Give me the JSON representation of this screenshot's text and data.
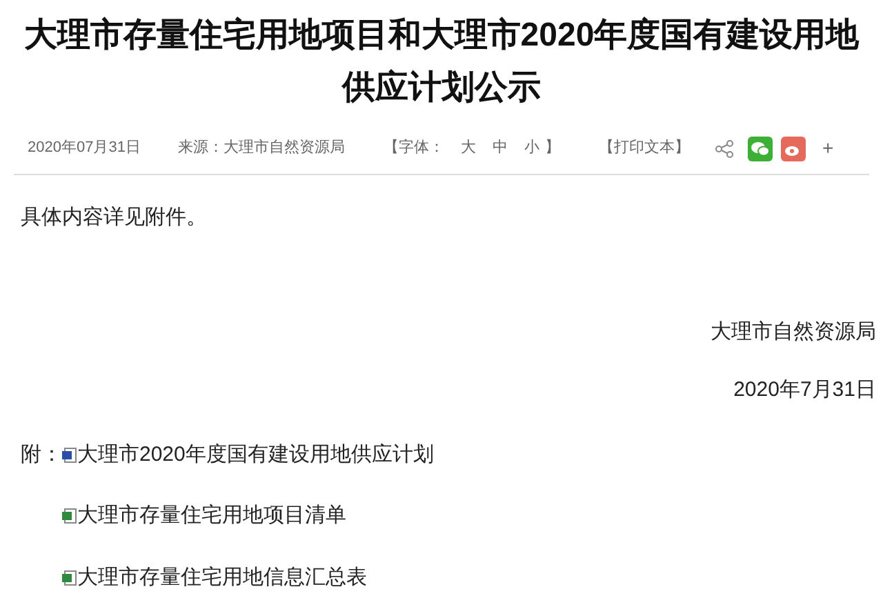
{
  "title": "大理市存量住宅用地项目和大理市2020年度国有建设用地供应计划公示",
  "meta": {
    "date": "2020年07月31日",
    "source": "来源：大理市自然资源局",
    "font_open": "【字体：",
    "font_sizes": [
      "大",
      "中",
      "小"
    ],
    "font_close": "】",
    "print": "【打印文本】",
    "share_plus": "+"
  },
  "body": "具体内容详见附件。",
  "signature": "大理市自然资源局",
  "sign_date": "2020年7月31日",
  "attachments_label": "附：",
  "attachments": [
    {
      "kind": "word",
      "name": "大理市2020年度国有建设用地供应计划"
    },
    {
      "kind": "excel",
      "name": "大理市存量住宅用地项目清单"
    },
    {
      "kind": "excel",
      "name": "大理市存量住宅用地信息汇总表"
    }
  ]
}
